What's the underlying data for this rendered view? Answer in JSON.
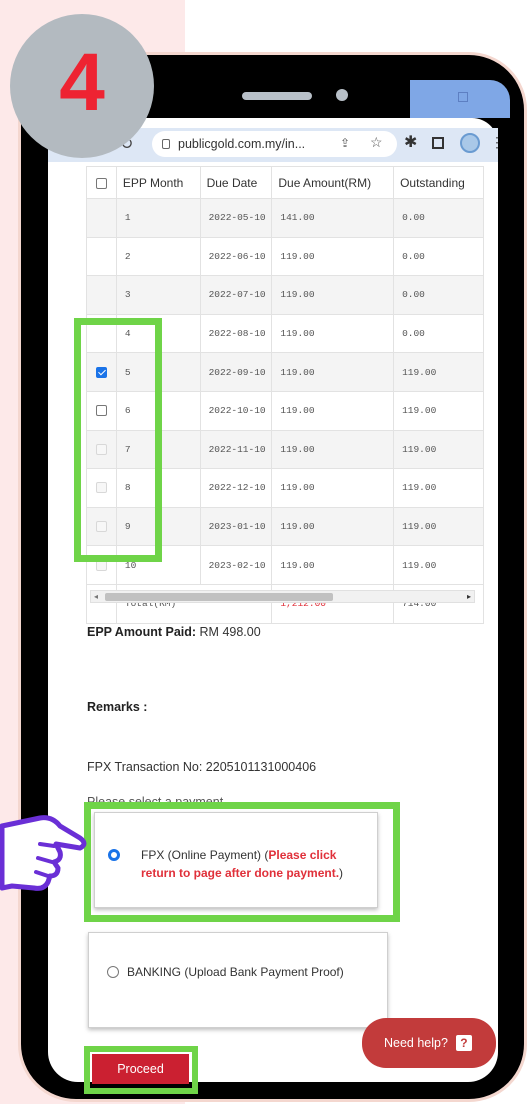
{
  "step": {
    "number": "4"
  },
  "browser": {
    "url": "publicgold.com.my/in..."
  },
  "table": {
    "headers": [
      "EPP Month",
      "Due Date",
      "Due Amount(RM)",
      "Outstanding"
    ],
    "rows": [
      {
        "month": "1",
        "due_date": "2022-05-10",
        "due_amount": "141.00",
        "outstanding": "0.00",
        "checkbox": "none"
      },
      {
        "month": "2",
        "due_date": "2022-06-10",
        "due_amount": "119.00",
        "outstanding": "0.00",
        "checkbox": "none"
      },
      {
        "month": "3",
        "due_date": "2022-07-10",
        "due_amount": "119.00",
        "outstanding": "0.00",
        "checkbox": "none"
      },
      {
        "month": "4",
        "due_date": "2022-08-10",
        "due_amount": "119.00",
        "outstanding": "0.00",
        "checkbox": "none"
      },
      {
        "month": "5",
        "due_date": "2022-09-10",
        "due_amount": "119.00",
        "outstanding": "119.00",
        "checkbox": "checked"
      },
      {
        "month": "6",
        "due_date": "2022-10-10",
        "due_amount": "119.00",
        "outstanding": "119.00",
        "checkbox": "unchecked"
      },
      {
        "month": "7",
        "due_date": "2022-11-10",
        "due_amount": "119.00",
        "outstanding": "119.00",
        "checkbox": "disabled"
      },
      {
        "month": "8",
        "due_date": "2022-12-10",
        "due_amount": "119.00",
        "outstanding": "119.00",
        "checkbox": "disabled"
      },
      {
        "month": "9",
        "due_date": "2023-01-10",
        "due_amount": "119.00",
        "outstanding": "119.00",
        "checkbox": "disabled"
      },
      {
        "month": "10",
        "due_date": "2023-02-10",
        "due_amount": "119.00",
        "outstanding": "119.00",
        "checkbox": "disabled"
      }
    ],
    "total": {
      "label": "Total(RM)",
      "due_amount": "1,212.00",
      "outstanding": "714.00"
    }
  },
  "epp_paid": {
    "label": "EPP Amount Paid:",
    "value": "RM 498.00"
  },
  "remarks": {
    "label": "Remarks :"
  },
  "fpx_transaction": "FPX Transaction No: 2205101131000406",
  "select_payment_label": "Please select a payment",
  "payment_options": {
    "fpx": {
      "label": "FPX (Online Payment) (",
      "note": "Please click return to page after done payment.",
      "close": ")",
      "selected": true
    },
    "banking": {
      "label": "BANKING (Upload Bank Payment Proof)",
      "selected": false
    }
  },
  "need_help": {
    "label": "Need help?",
    "icon": "?"
  },
  "proceed": {
    "label": "Proceed"
  },
  "colors": {
    "highlight_green": "#6fd448",
    "brand_red": "#cb2031",
    "accent_blue": "#1a73e8",
    "step_red": "#ee2332"
  }
}
